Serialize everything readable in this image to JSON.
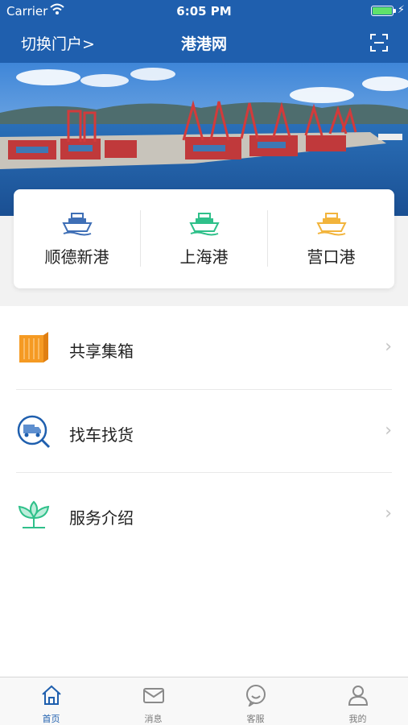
{
  "status_bar": {
    "carrier": "Carrier",
    "time": "6:05 PM"
  },
  "nav_bar": {
    "switch_portal": "切换门户>",
    "title": "港港网"
  },
  "ports": [
    {
      "label": "顺德新港",
      "icon": "ship-icon",
      "color": "#3f6fb6"
    },
    {
      "label": "上海港",
      "icon": "ship-icon",
      "color": "#2fc08a"
    },
    {
      "label": "营口港",
      "icon": "ship-icon",
      "color": "#f2b43c"
    }
  ],
  "menu": [
    {
      "label": "共享集箱",
      "icon": "container-icon"
    },
    {
      "label": "找车找货",
      "icon": "truck-search-icon"
    },
    {
      "label": "服务介绍",
      "icon": "lotus-icon"
    }
  ],
  "tabs": [
    {
      "label": "首页",
      "icon": "home-icon",
      "active": true
    },
    {
      "label": "消息",
      "icon": "mail-icon",
      "active": false
    },
    {
      "label": "客服",
      "icon": "chat-icon",
      "active": false
    },
    {
      "label": "我的",
      "icon": "user-icon",
      "active": false
    }
  ],
  "colors": {
    "primary": "#1f5fae",
    "battery": "#5fe26b"
  }
}
